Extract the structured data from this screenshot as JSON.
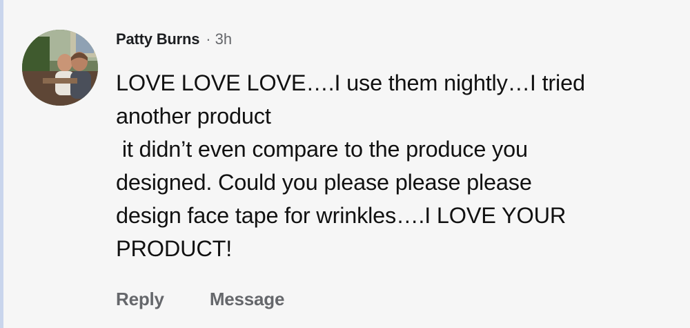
{
  "comment": {
    "author": "Patty Burns",
    "separator": "·",
    "timestamp": "3h",
    "text": "LOVE LOVE LOVE….I use them nightly…I tried\nanother product\n it didn’t even compare to the produce you\ndesigned. Could you please please please\ndesign face tape for wrinkles….I LOVE YOUR\nPRODUCT!",
    "actions": {
      "reply_label": "Reply",
      "message_label": "Message"
    }
  },
  "colors": {
    "background": "#f6f6f6",
    "author": "#1c1e21",
    "secondary_text": "#65676b",
    "body_text": "#111111",
    "left_rule": "#c9d5ec"
  }
}
